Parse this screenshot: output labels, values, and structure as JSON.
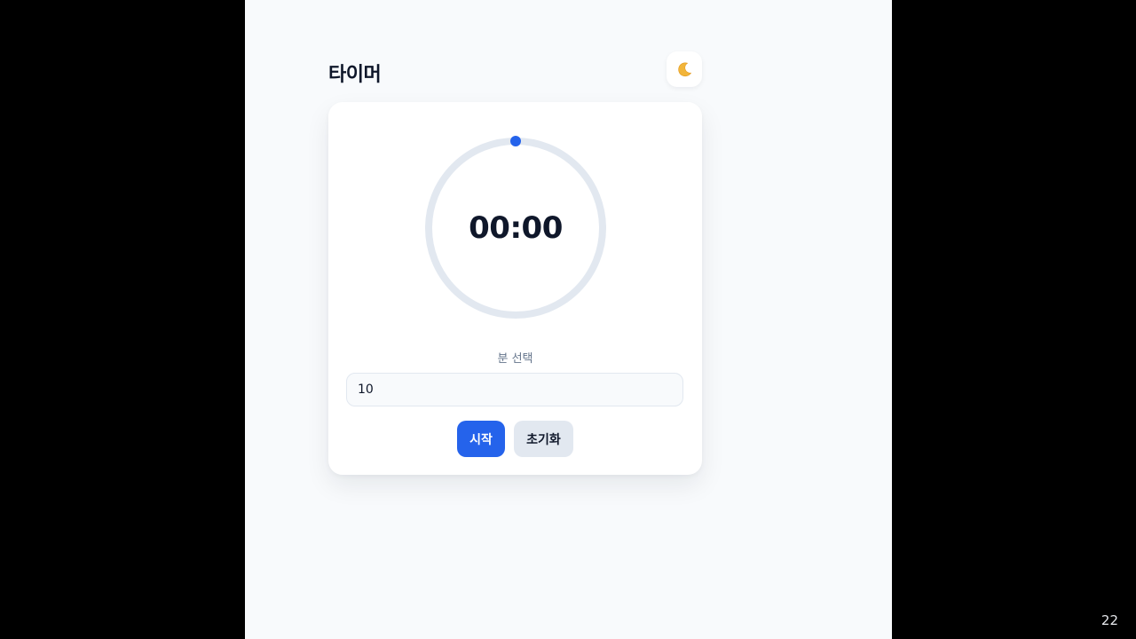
{
  "header": {
    "title": "타이머",
    "theme_toggle_icon": "moon-icon"
  },
  "timer": {
    "display": "00:00",
    "progress": 0,
    "ring_track_color": "#e2e8f0",
    "accent_color": "#2563eb"
  },
  "controls": {
    "minute_label": "분 선택",
    "minute_value": "10",
    "start_label": "시작",
    "reset_label": "초기화"
  },
  "slide": {
    "number": "22"
  }
}
